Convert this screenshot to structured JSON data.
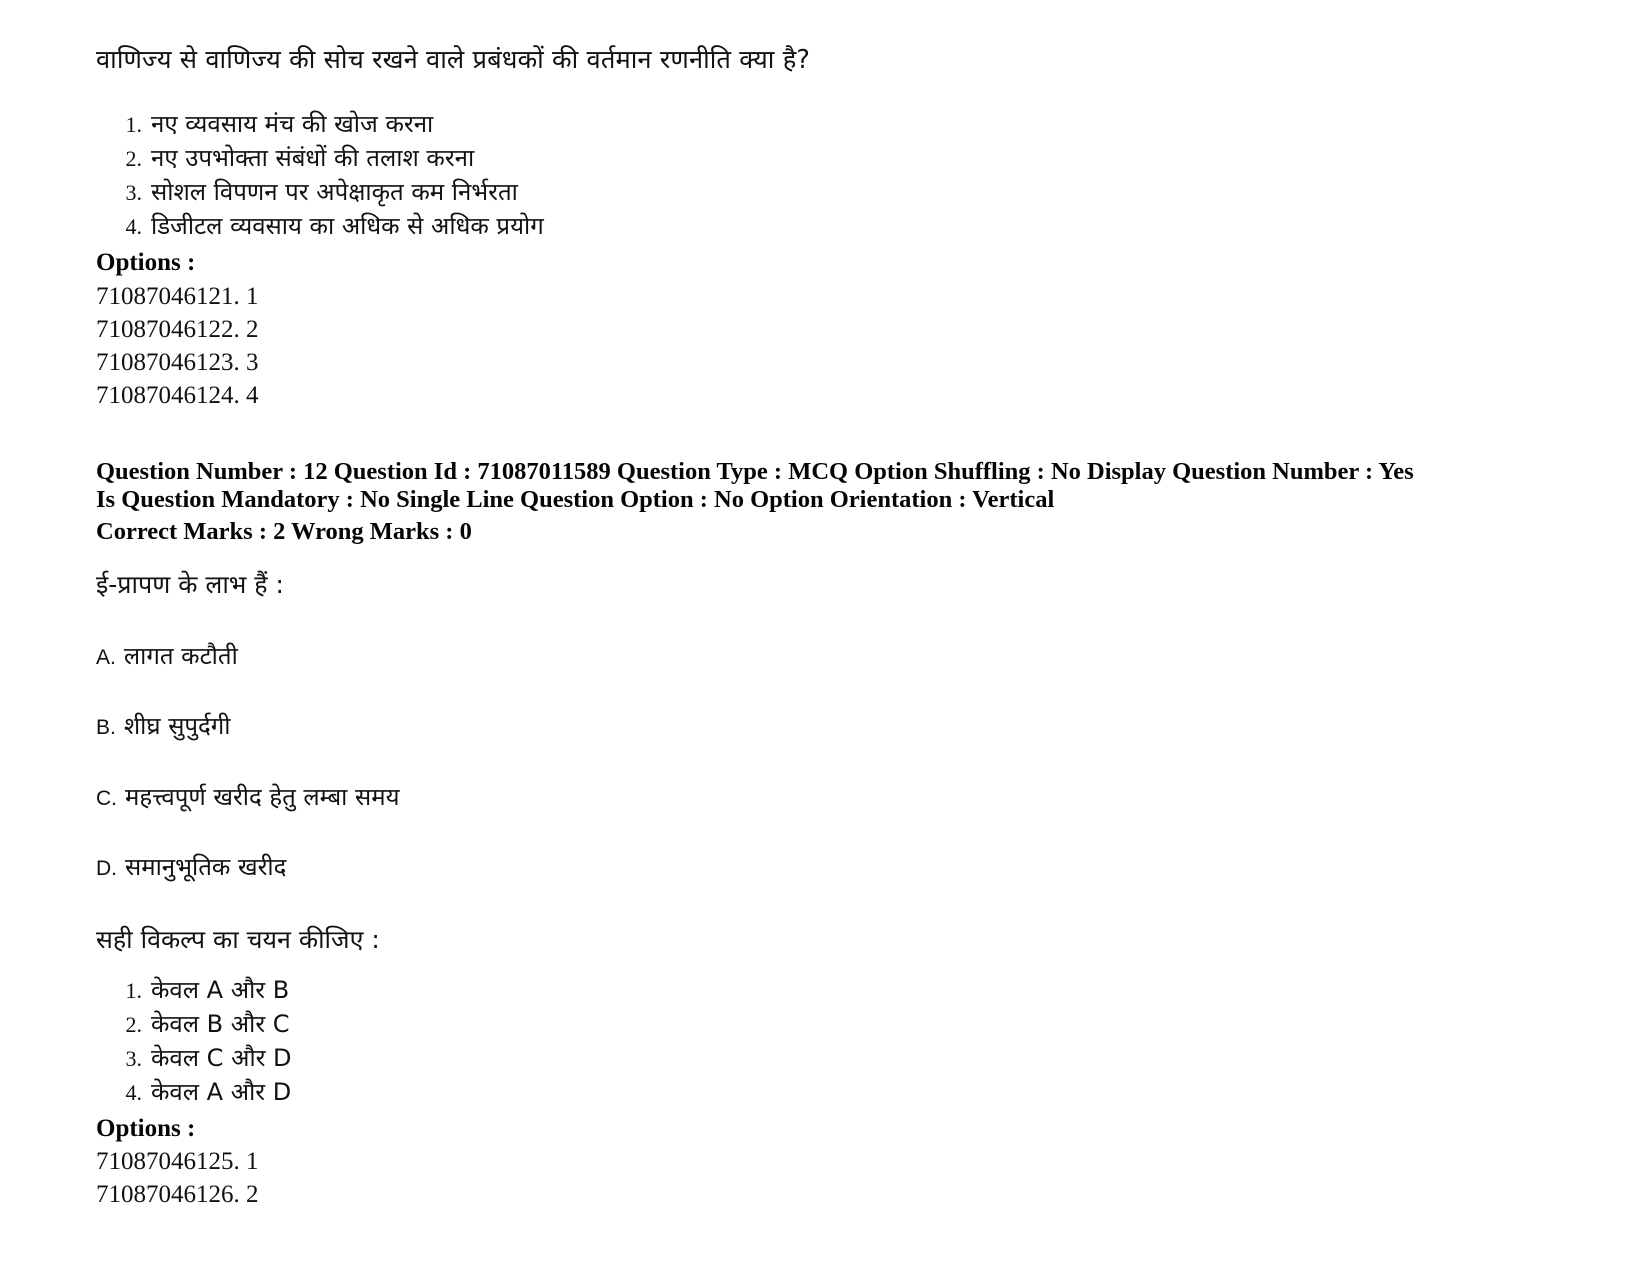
{
  "document": {
    "type": "exam-question-paper",
    "language": "Hindi"
  },
  "question_11": {
    "stem": "वाणिज्य से वाणिज्य की सोच रखने वाले प्रबंधकों की वर्तमान रणनीति क्या है?",
    "choices": [
      {
        "num": "1.",
        "text": "नए व्यवसाय मंच की खोज करना"
      },
      {
        "num": "2.",
        "text": "नए उपभोक्ता संबंधों की तलाश करना"
      },
      {
        "num": "3.",
        "text": "सोशल विपणन पर अपेक्षाकृत कम निर्भरता"
      },
      {
        "num": "4.",
        "text": "डिजीटल व्यवसाय का अधिक से अधिक प्रयोग"
      }
    ],
    "options_label": "Options :",
    "option_ids": [
      "71087046121. 1",
      "71087046122. 2",
      "71087046123. 3",
      "71087046124. 4"
    ]
  },
  "question_12": {
    "metadata_line": "Question Number : 12 Question Id : 71087011589 Question Type : MCQ Option Shuffling : No Display Question Number : Yes Is Question Mandatory : No Single Line Question Option : No Option Orientation : Vertical",
    "marks_line": "Correct Marks : 2 Wrong Marks : 0",
    "metadata_fields": {
      "question_number": "12",
      "question_id": "71087011589",
      "question_type": "MCQ",
      "option_shuffling": "No",
      "display_question_number": "Yes",
      "is_question_mandatory": "No",
      "single_line_question_option": "No",
      "option_orientation": "Vertical",
      "correct_marks": "2",
      "wrong_marks": "0"
    },
    "stem": "ई-प्रापण के लाभ हैं :",
    "statements": [
      {
        "letter": "A.",
        "text": "लागत कटौती"
      },
      {
        "letter": "B.",
        "text": "शीघ्र सुपुर्दगी"
      },
      {
        "letter": "C.",
        "text": "महत्त्वपूर्ण खरीद हेतु लम्बा समय"
      },
      {
        "letter": "D.",
        "text": "समानुभूतिक खरीद"
      }
    ],
    "instruction": "सही विकल्प का चयन कीजिए :",
    "choices": [
      {
        "num": "1.",
        "text": "केवल A और B"
      },
      {
        "num": "2.",
        "text": "केवल B और C"
      },
      {
        "num": "3.",
        "text": "केवल C और D"
      },
      {
        "num": "4.",
        "text": "केवल A और D"
      }
    ],
    "options_label": "Options :",
    "option_ids": [
      "71087046125. 1",
      "71087046126. 2"
    ]
  }
}
